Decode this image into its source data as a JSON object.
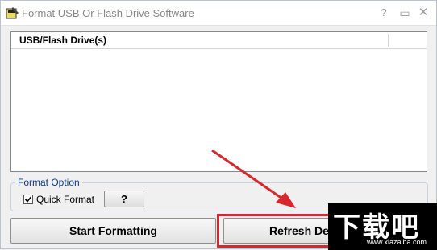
{
  "window": {
    "title": "Format USB Or Flash Drive Software"
  },
  "titlebar_buttons": {
    "help": "?",
    "minimize": "▭",
    "close": "✕"
  },
  "list": {
    "column_header": "USB/Flash Drive(s)",
    "rows": []
  },
  "format_option": {
    "group_label": "Format Option",
    "quick_format_label": "Quick Format",
    "quick_format_checked": true,
    "help_button": "?"
  },
  "actions": {
    "start_label": "Start Formatting",
    "refresh_label": "Refresh De"
  },
  "annotation": {
    "highlight_color": "#d9262c"
  },
  "watermark": {
    "logo": "下载吧",
    "url": "www.xiazaiba.com"
  }
}
